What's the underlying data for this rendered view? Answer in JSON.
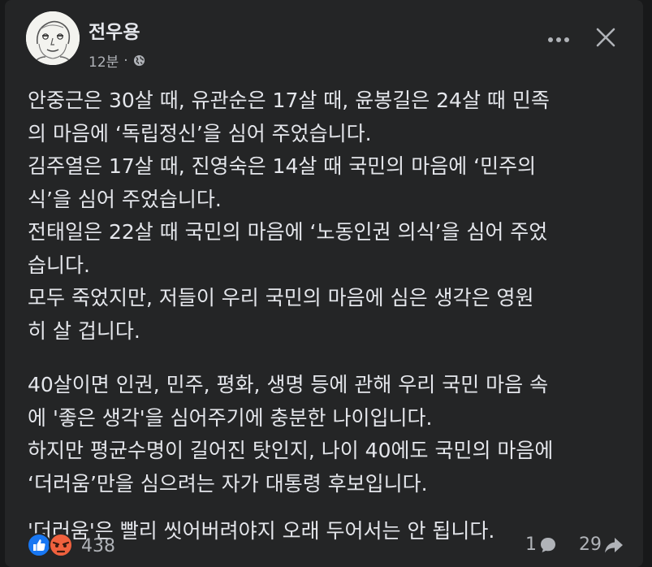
{
  "post": {
    "author": "전우용",
    "time": "12분",
    "separator": "·",
    "privacy_icon": "globe-icon",
    "paragraphs": [
      [
        "안중근은 30살 때, 유관순은 17살 때, 윤봉길은 24살 때 민족",
        "의 마음에 ‘독립정신’을 심어 주었습니다.",
        "김주열은 17살 때, 진영숙은 14살 때 국민의 마음에 ‘민주의",
        "식’을 심어 주었습니다.",
        "전태일은 22살 때 국민의 마음에 ‘노동인권 의식’을 심어 주었",
        "습니다.",
        "모두 죽었지만, 저들이 우리 국민의 마음에 심은 생각은 영원",
        "히 살 겁니다."
      ],
      [
        "40살이면 인권, 민주, 평화, 생명 등에 관해 우리 국민 마음 속",
        "에 '좋은 생각'을 심어주기에 충분한 나이입니다.",
        "하지만 평균수명이 길어진 탓인지, 나이 40에도 국민의 마음에",
        "‘더러움’만을 심으려는 자가 대통령 후보입니다."
      ],
      [
        "'더러움'은 빨리 씻어버려야지 오래 두어서는 안 됩니다."
      ]
    ]
  },
  "footer": {
    "reactions": [
      "like-icon",
      "angry-icon"
    ],
    "reaction_count": "438",
    "comment_count": "1",
    "share_count": "29"
  },
  "colors": {
    "background": "#242526",
    "text": "#e4e6eb",
    "secondary_text": "#b0b3b8",
    "like_blue": "#1877f2",
    "angry_orange": "#f0613e"
  }
}
